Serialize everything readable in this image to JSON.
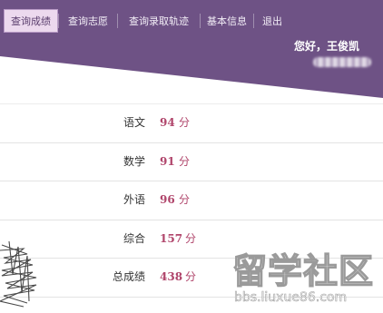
{
  "colors": {
    "banner": "#6e5285",
    "active_tab_bg": "#ecd9ee",
    "score_accent": "#b0456b"
  },
  "nav": {
    "items": [
      {
        "label": "查询成绩",
        "active": true
      },
      {
        "label": "查询志愿",
        "active": false
      },
      {
        "label": "查询录取轨迹",
        "active": false
      },
      {
        "label": "基本信息",
        "active": false
      },
      {
        "label": "退出",
        "active": false
      }
    ]
  },
  "header": {
    "greeting": "您好，王俊凯"
  },
  "scores": [
    {
      "subject": "语文",
      "score": "94",
      "unit": "分"
    },
    {
      "subject": "数学",
      "score": "91",
      "unit": "分"
    },
    {
      "subject": "外语",
      "score": "96",
      "unit": "分"
    },
    {
      "subject": "综合",
      "score": "157",
      "unit": "分"
    },
    {
      "subject": "总成绩",
      "score": "438",
      "unit": "分"
    }
  ],
  "watermark": {
    "title": "留学社区",
    "url": "bbs.liuxue86.com"
  }
}
